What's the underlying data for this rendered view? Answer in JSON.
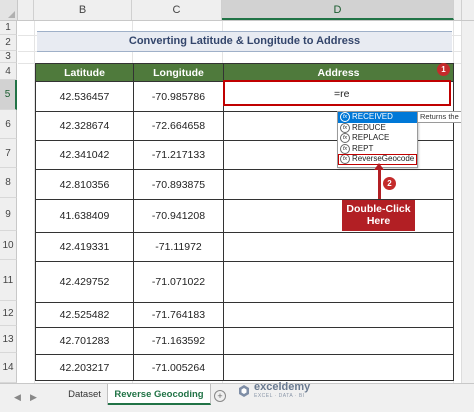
{
  "columns": [
    "B",
    "C",
    "D"
  ],
  "selected_column": "D",
  "rows": [
    "1",
    "2",
    "3",
    "4",
    "5",
    "6",
    "7",
    "8",
    "9",
    "10",
    "11",
    "12",
    "13",
    "14"
  ],
  "selected_row": "5",
  "title": "Converting Latitude & Longitude to Address",
  "table": {
    "headers": [
      "Latitude",
      "Longitude",
      "Address"
    ],
    "rows": [
      {
        "lat": "42.536457",
        "lon": "-70.985786"
      },
      {
        "lat": "42.328674",
        "lon": "-72.664658"
      },
      {
        "lat": "42.341042",
        "lon": "-71.217133"
      },
      {
        "lat": "42.810356",
        "lon": "-70.893875"
      },
      {
        "lat": "41.638409",
        "lon": "-70.941208"
      },
      {
        "lat": "42.419331",
        "lon": "-71.11972"
      },
      {
        "lat": "42.429752",
        "lon": "-71.071022"
      },
      {
        "lat": "42.525482",
        "lon": "-71.764183"
      },
      {
        "lat": "42.701283",
        "lon": "-71.163592"
      },
      {
        "lat": "42.203217",
        "lon": "-71.005264"
      }
    ]
  },
  "active_cell": {
    "value": "=re"
  },
  "badges": {
    "one": "1",
    "two": "2"
  },
  "autocomplete": {
    "items": [
      "RECEIVED",
      "REDUCE",
      "REPLACE",
      "REPT",
      "ReverseGeocode"
    ],
    "highlighted": "RECEIVED",
    "boxed": "ReverseGeocode",
    "fx_glyph": "fx",
    "tooltip": "Returns the amount received at maturity for a fully invested security"
  },
  "callout": {
    "line1": "Double-Click",
    "line2": "Here"
  },
  "sheet_tabs": {
    "items": [
      "Dataset",
      "Reverse Geocoding"
    ],
    "active": "Reverse Geocoding",
    "nav_prev": "◀",
    "nav_next": "▶",
    "add": "+"
  },
  "watermark": {
    "name": "exceldemy",
    "sub": "EXCEL · DATA · BI"
  },
  "colors": {
    "header_green": "#4f7a3c",
    "callout_red": "#b21f24",
    "accent": "#217346",
    "title_bg": "#e8ebf2"
  }
}
